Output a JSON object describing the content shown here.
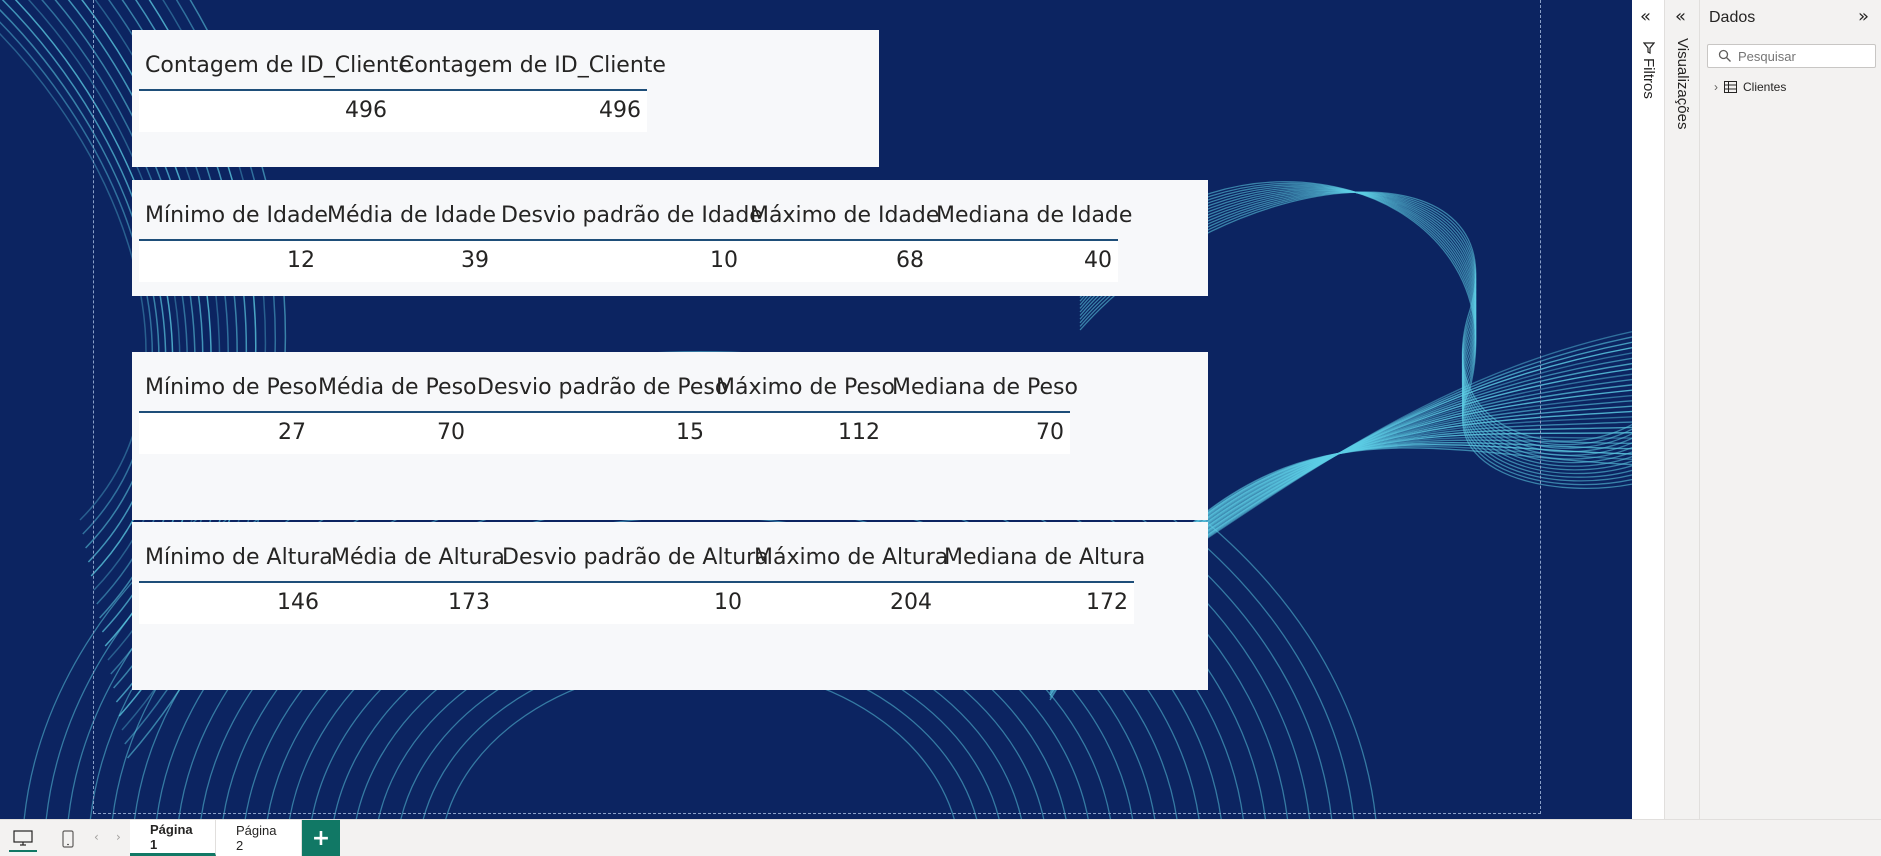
{
  "visuals": [
    {
      "columns": [
        {
          "header": "Contagem de ID_Cliente",
          "value": "496"
        },
        {
          "header": "Contagem de ID_Cliente",
          "value": "496"
        }
      ]
    },
    {
      "columns": [
        {
          "header": "Mínimo de Idade",
          "value": "12"
        },
        {
          "header": "Média de Idade",
          "value": "39"
        },
        {
          "header": "Desvio padrão de Idade",
          "value": "10"
        },
        {
          "header": "Máximo de Idade",
          "value": "68"
        },
        {
          "header": "Mediana de Idade",
          "value": "40"
        }
      ]
    },
    {
      "columns": [
        {
          "header": "Mínimo de Peso",
          "value": "27"
        },
        {
          "header": "Média de Peso",
          "value": "70"
        },
        {
          "header": "Desvio padrão de Peso",
          "value": "15"
        },
        {
          "header": "Máximo de Peso",
          "value": "112"
        },
        {
          "header": "Mediana de Peso",
          "value": "70"
        }
      ]
    },
    {
      "columns": [
        {
          "header": "Mínimo de Altura",
          "value": "146"
        },
        {
          "header": "Média de Altura",
          "value": "173"
        },
        {
          "header": "Desvio padrão de Altura",
          "value": "10"
        },
        {
          "header": "Máximo de Altura",
          "value": "204"
        },
        {
          "header": "Mediana de Altura",
          "value": "172"
        }
      ]
    }
  ],
  "panes": {
    "filters_label": "Filtros",
    "filters_icon": "funnel-icon",
    "visualizations_label": "Visualizações",
    "data_title": "Dados",
    "search_placeholder": "Pesquisar",
    "tables": [
      {
        "name": "Clientes",
        "icon": "table-icon"
      }
    ]
  },
  "pages": {
    "tabs": [
      "Página 1",
      "Página 2"
    ],
    "active": "Página 1",
    "add_label": "+"
  },
  "colors": {
    "canvas_background": "#0c2461",
    "wave": "#5ecfe6",
    "accent": "#117865",
    "visual_background": "#f7f8fa",
    "header_rule": "#1e4e79"
  }
}
